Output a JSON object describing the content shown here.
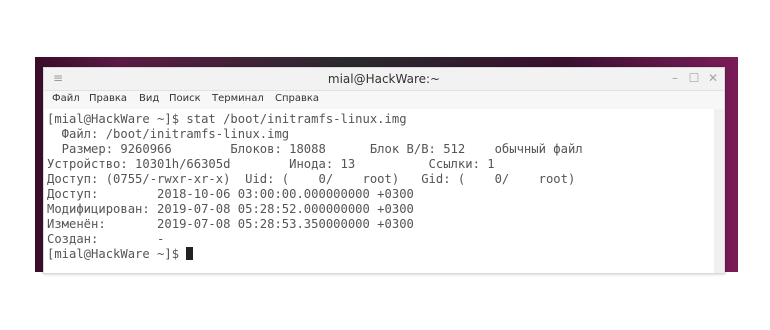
{
  "window": {
    "title": "mial@HackWare:~",
    "controls": {
      "menu": "≡",
      "minimize": "–",
      "maximize": "☐",
      "close": "✕"
    }
  },
  "menubar": [
    "Файл",
    "Правка",
    "Вид",
    "Поиск",
    "Терминал",
    "Справка"
  ],
  "terminal": {
    "lines": [
      "[mial@HackWare ~]$ stat /boot/initramfs-linux.img",
      "  Файл: /boot/initramfs-linux.img",
      "  Размер: 9260966        Блоков: 18088      Блок В/В: 512    обычный файл",
      "Устройство: 10301h/66305d        Инода: 13          Ссылки: 1",
      "Доступ: (0755/-rwxr-xr-x)  Uid: (    0/    root)   Gid: (    0/    root)",
      "Доступ:        2018-10-06 03:00:00.000000000 +0300",
      "Модифицирован: 2019-07-08 05:28:52.000000000 +0300",
      "Изменён:       2019-07-08 05:28:53.350000000 +0300",
      "Создан:        -"
    ],
    "prompt": "[mial@HackWare ~]$ "
  }
}
